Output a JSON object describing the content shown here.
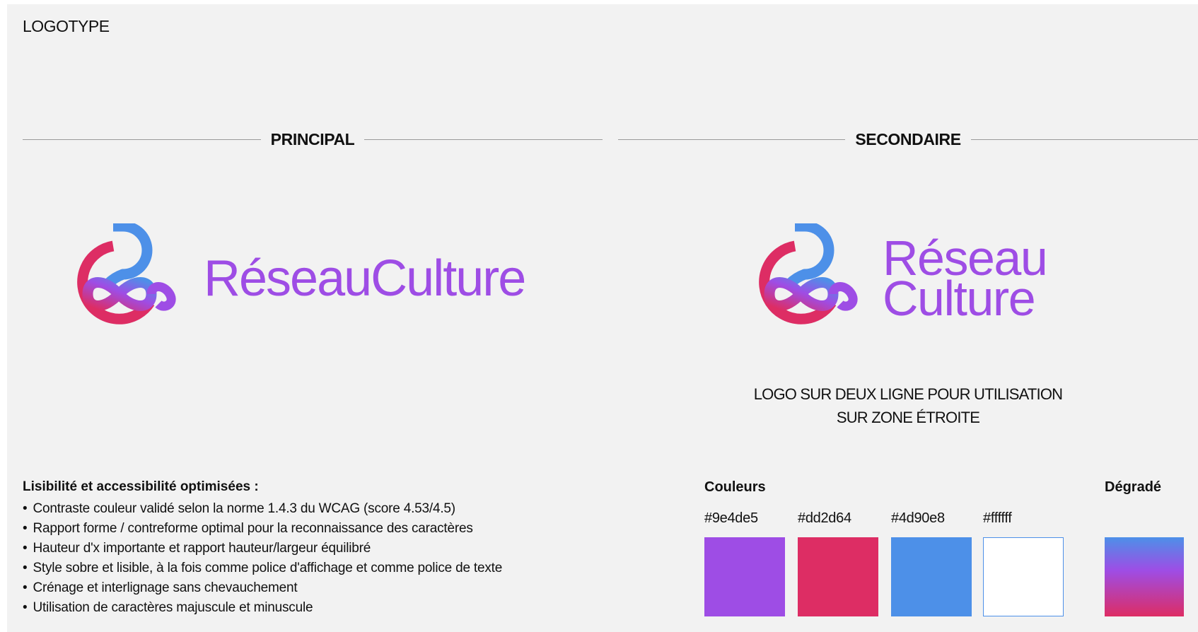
{
  "page": {
    "title": "LOGOTYPE"
  },
  "sections": {
    "principal": "PRINCIPAL",
    "secondaire": "SECONDAIRE"
  },
  "logo": {
    "wordmark_one_line": "RéseauCulture",
    "wordmark_line1": "Réseau",
    "wordmark_line2": "Culture",
    "secondary_caption_line1": "LOGO SUR DEUX LIGNE POUR UTILISATION",
    "secondary_caption_line2": "SUR ZONE ÉTROITE"
  },
  "accessibility": {
    "heading": "Lisibilité et accessibilité optimisées :",
    "items": [
      "Contraste couleur validé selon la norme 1.4.3 du WCAG (score 4.53/4.5)",
      "Rapport forme / contreforme optimal pour la reconnaissance des caractères",
      "Hauteur d'x importante et rapport hauteur/largeur équilibré",
      "Style sobre et lisible, à la fois comme police d'affichage et comme police de texte",
      "Crénage et interlignage sans chevauchement",
      "Utilisation de caractères majuscule et minuscule"
    ]
  },
  "palette": {
    "title": "Couleurs",
    "swatches": [
      {
        "hex": "#9e4de5"
      },
      {
        "hex": "#dd2d64"
      },
      {
        "hex": "#4d90e8"
      },
      {
        "hex": "#ffffff"
      }
    ]
  },
  "gradient": {
    "title": "Dégradé",
    "colors": [
      "#4d90e8",
      "#9e4de5",
      "#dd2d64"
    ]
  }
}
